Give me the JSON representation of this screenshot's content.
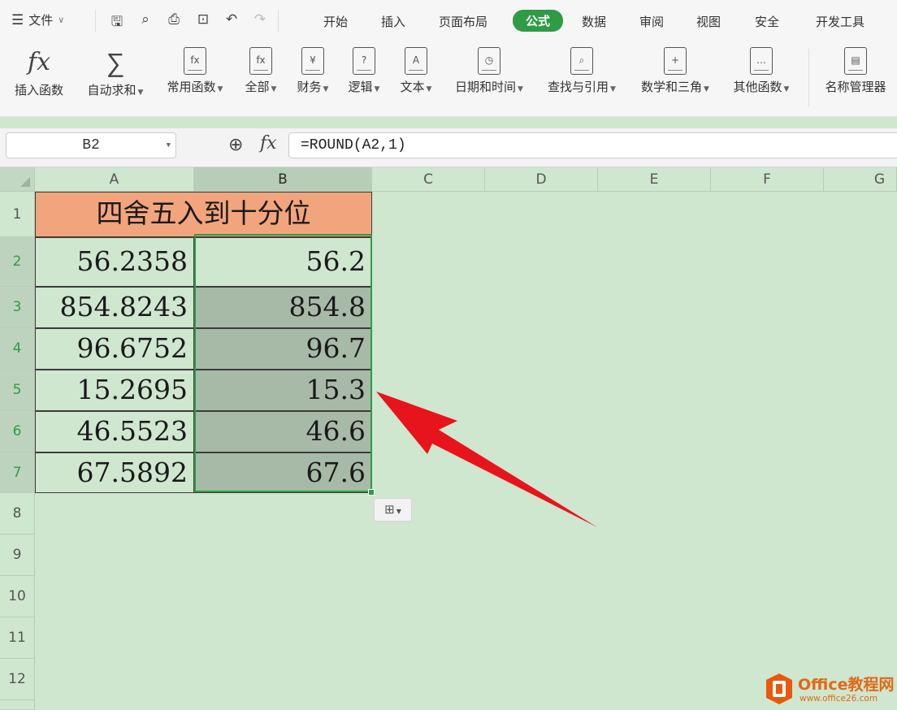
{
  "menubar": {
    "file_label": "文件",
    "tabs": [
      {
        "label": "开始"
      },
      {
        "label": "插入"
      },
      {
        "label": "页面布局"
      },
      {
        "label": "公式",
        "active": true
      },
      {
        "label": "数据"
      },
      {
        "label": "审阅"
      },
      {
        "label": "视图"
      },
      {
        "label": "安全"
      },
      {
        "label": "开发工具"
      }
    ],
    "quick_access_icons": [
      "save-icon",
      "format-painter-icon",
      "print-icon",
      "print-preview-icon",
      "undo-icon",
      "redo-icon"
    ]
  },
  "ribbon": {
    "items": [
      {
        "label": "插入函数",
        "icon": "fx-icon",
        "glyph": "fx"
      },
      {
        "label": "自动求和",
        "icon": "sigma-icon",
        "glyph": "∑",
        "dropdown": true
      },
      {
        "label": "常用函数",
        "icon": "common-functions-icon",
        "glyph": "fx",
        "dropdown": true
      },
      {
        "label": "全部",
        "icon": "all-functions-icon",
        "glyph": "fx",
        "dropdown": true
      },
      {
        "label": "财务",
        "icon": "finance-icon",
        "glyph": "¥",
        "dropdown": true
      },
      {
        "label": "逻辑",
        "icon": "logic-icon",
        "glyph": "?",
        "dropdown": true
      },
      {
        "label": "文本",
        "icon": "text-icon",
        "glyph": "A",
        "dropdown": true
      },
      {
        "label": "日期和时间",
        "icon": "datetime-icon",
        "glyph": "◷",
        "dropdown": true
      },
      {
        "label": "查找与引用",
        "icon": "lookup-icon",
        "glyph": "⌕",
        "dropdown": true
      },
      {
        "label": "数学和三角",
        "icon": "math-icon",
        "glyph": "+",
        "dropdown": true
      },
      {
        "label": "其他函数",
        "icon": "other-functions-icon",
        "glyph": "…",
        "dropdown": true
      },
      {
        "label": "名称管理器",
        "icon": "name-manager-icon",
        "glyph": "▤"
      }
    ]
  },
  "formula_bar": {
    "name_box": "B2",
    "formula": "=ROUND(A2,1)"
  },
  "grid": {
    "columns": [
      "A",
      "B",
      "C",
      "D",
      "E",
      "F",
      "G"
    ],
    "selected_column": "B",
    "rows": [
      "1",
      "2",
      "3",
      "4",
      "5",
      "6",
      "7",
      "8",
      "9",
      "10",
      "11",
      "12"
    ],
    "selected_rows": [
      "2",
      "3",
      "4",
      "5",
      "6",
      "7"
    ],
    "title": "四舍五入到十分位",
    "data": [
      {
        "a": "56.2358",
        "b": "56.2"
      },
      {
        "a": "854.8243",
        "b": "854.8"
      },
      {
        "a": "96.6752",
        "b": "96.7"
      },
      {
        "a": "15.2695",
        "b": "15.3"
      },
      {
        "a": "46.5523",
        "b": "46.6"
      },
      {
        "a": "67.5892",
        "b": "67.6"
      }
    ]
  },
  "watermark": {
    "title": "Office教程网",
    "url": "www.office26.com"
  },
  "colors": {
    "accent": "#2e9b47",
    "title_fill": "#f2a57c",
    "sheet_bg": "#cfe6cf",
    "selection_fill": "#a7baa7",
    "arrow": "#e8141c",
    "watermark": "#e06a17"
  }
}
